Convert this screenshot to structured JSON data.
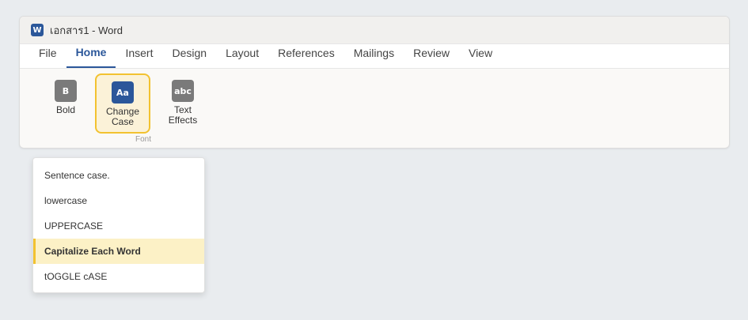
{
  "window": {
    "logo_letter": "W",
    "title": "เอกสาร1 - Word"
  },
  "tabs": [
    {
      "label": "File"
    },
    {
      "label": "Home",
      "active": true
    },
    {
      "label": "Insert"
    },
    {
      "label": "Design"
    },
    {
      "label": "Layout"
    },
    {
      "label": "References"
    },
    {
      "label": "Mailings"
    },
    {
      "label": "Review"
    },
    {
      "label": "View"
    }
  ],
  "ribbon": {
    "bold": {
      "icon": "B",
      "label": "Bold"
    },
    "change_case": {
      "icon": "Aa",
      "label_line1": "Change",
      "label_line2": "Case"
    },
    "text_effects": {
      "icon": "abc",
      "label_line1": "Text",
      "label_line2": "Effects"
    },
    "group_label": "Font"
  },
  "dropdown": {
    "items": [
      {
        "label": "Sentence case."
      },
      {
        "label": "lowercase"
      },
      {
        "label": "UPPERCASE"
      },
      {
        "label": "Capitalize Each Word",
        "selected": true
      },
      {
        "label": "tOGGLE cASE"
      }
    ]
  },
  "colors": {
    "accent": "#2b579a",
    "highlight_border": "#f2c230",
    "highlight_fill": "#fcf1c6"
  }
}
